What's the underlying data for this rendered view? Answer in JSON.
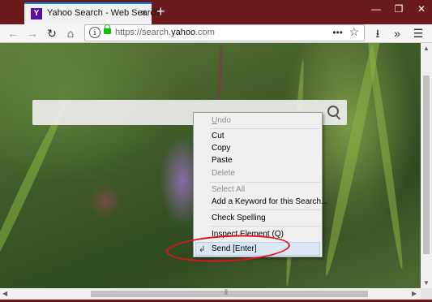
{
  "tab": {
    "title": "Yahoo Search - Web Search",
    "favicon": "Y",
    "close_icon": "×"
  },
  "browser": {
    "new_tab_label": "+",
    "window_controls": [
      "—",
      "❐",
      "✕"
    ],
    "back_icon": "←",
    "forward_icon": "→",
    "reload_icon": "↻",
    "home_icon": "⌂",
    "url_scheme": "https://search.",
    "url_domain": "yahoo",
    "url_rest": ".com",
    "page_actions_icon": "•••",
    "bookmark_icon": "☆",
    "downloads_icon": "⭳",
    "overflow_icon": "»",
    "menu_icon": "☰"
  },
  "context_menu": {
    "items": [
      {
        "label": "Undo",
        "enabled": false
      },
      {
        "label": "Cut",
        "enabled": true
      },
      {
        "label": "Copy",
        "enabled": true
      },
      {
        "label": "Paste",
        "enabled": true
      },
      {
        "label": "Delete",
        "enabled": false
      },
      {
        "label": "Select All",
        "enabled": false
      },
      {
        "label": "Add a Keyword for this Search...",
        "enabled": true
      },
      {
        "label": "Check Spelling",
        "enabled": true
      },
      {
        "label": "Inspect Element (Q)",
        "enabled": true
      },
      {
        "label": "Send [Enter]",
        "enabled": true,
        "highlighted": true
      }
    ],
    "send_icon": "↲"
  },
  "scroll": {
    "grip": "⦀",
    "up": "▲",
    "down": "▼",
    "left": "◀",
    "right": "▶"
  },
  "colors": {
    "annotation_ring": "#e0131b",
    "lock": "#12bc00",
    "tab_accent": "#0a84ff"
  }
}
